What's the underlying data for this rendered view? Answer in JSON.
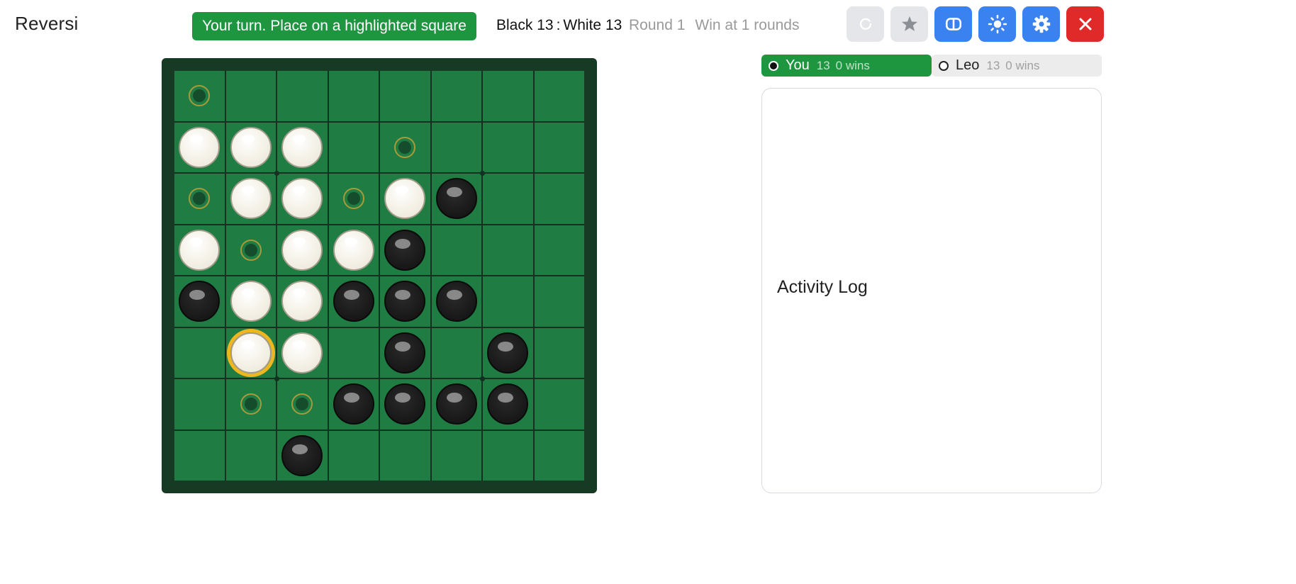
{
  "app": {
    "title": "Reversi"
  },
  "status": {
    "message": "Your turn. Place on a highlighted square"
  },
  "score": {
    "black_label": "Black",
    "black": "13",
    "separator": ":",
    "white_label": "White",
    "white": "13"
  },
  "round": {
    "round_text": "Round 1",
    "win_text": "Win at 1 rounds"
  },
  "toolbar": {
    "buttons": [
      {
        "icon": "refresh-icon",
        "color": "#e4e6ea",
        "enabled": false
      },
      {
        "icon": "star-icon",
        "color": "#e4e6ea",
        "enabled": false
      },
      {
        "icon": "layout-toggle-icon",
        "color": "#3a82f0",
        "enabled": true
      },
      {
        "icon": "brightness-icon",
        "color": "#3a82f0",
        "enabled": true
      },
      {
        "icon": "gear-icon",
        "color": "#3a82f0",
        "enabled": true
      },
      {
        "icon": "close-icon",
        "color": "#e02a2a",
        "enabled": true
      }
    ]
  },
  "board": {
    "size": 8,
    "legend": "B = black, W = white, . = legal move hint, - = empty",
    "rows": [
      ".-------",
      "WWW-.---",
      ".WW.WB--",
      "W.WWB---",
      "BWWBBB--",
      "-WW-B-B-",
      "-..BBBB-",
      "--B-----"
    ],
    "last_move": {
      "row": 5,
      "col": 1
    },
    "colors": {
      "cell": "#1f7d44",
      "frame": "#173a25",
      "highlight": "#f0b620"
    }
  },
  "players": [
    {
      "name": "You",
      "piece": "black",
      "score": "13",
      "wins": "0 wins",
      "active": true
    },
    {
      "name": "Leo",
      "piece": "white",
      "score": "13",
      "wins": "0 wins",
      "active": false
    }
  ],
  "activity_log": {
    "title": "Activity Log",
    "entries": []
  }
}
